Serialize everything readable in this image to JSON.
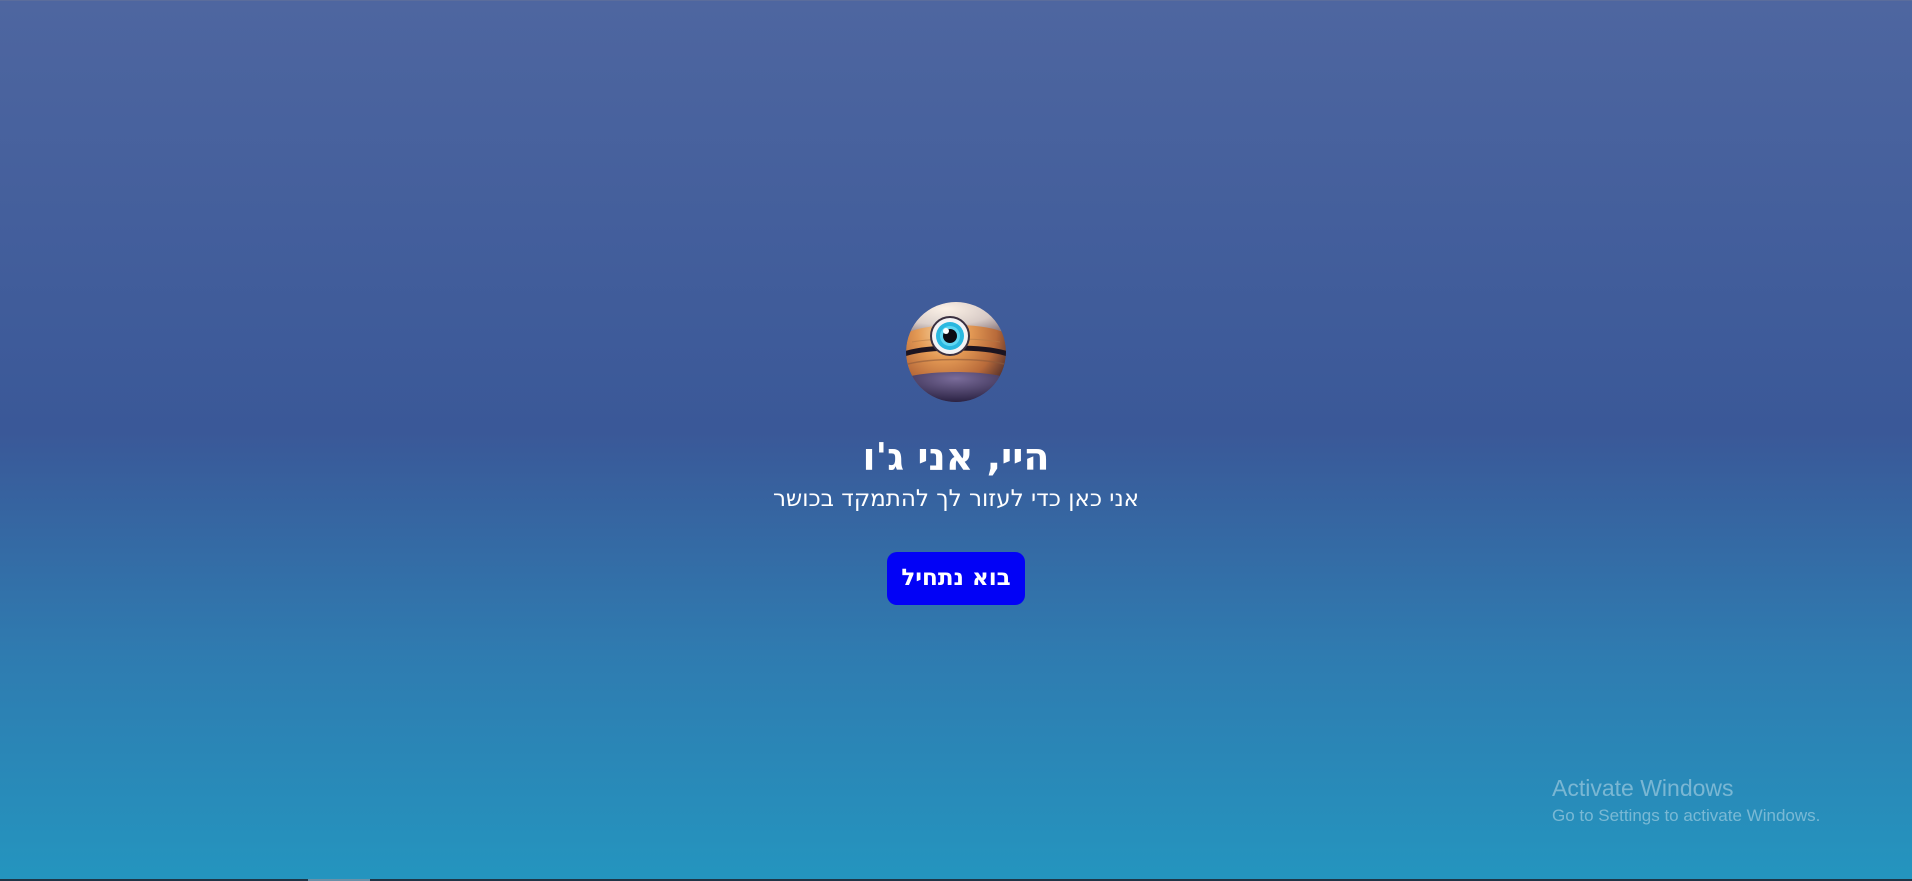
{
  "hero": {
    "avatar_icon": "eye-ball-robot-icon",
    "title": "היי, אני ג'ו",
    "subtitle": "אני כאן כדי לעזור לך להתמקד בכושר",
    "start_button_label": "בוא נתחיל"
  },
  "watermark": {
    "title": "Activate Windows",
    "subtitle": "Go to Settings to activate Windows."
  },
  "colors": {
    "background_top": "#4e66a0",
    "background_mid": "#3a5898",
    "background_bottom": "#2495bf",
    "button": "#0202f6",
    "text": "#ffffff"
  }
}
